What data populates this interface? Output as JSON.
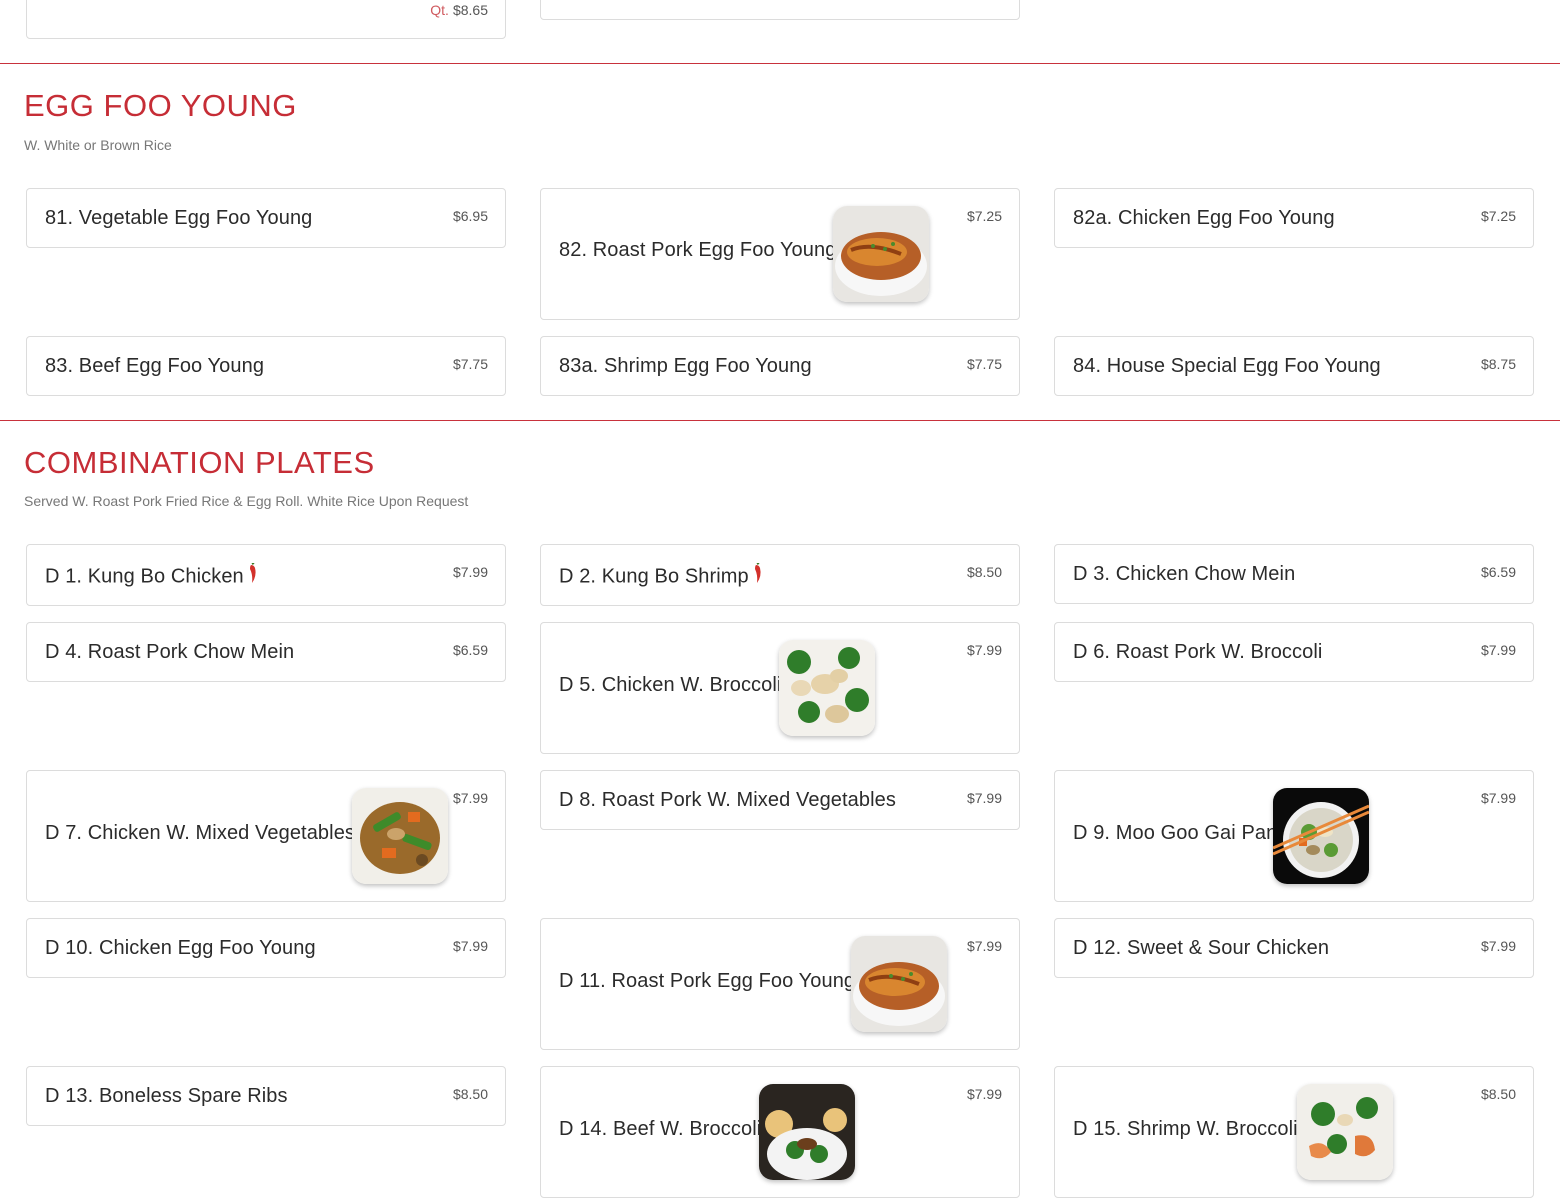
{
  "top_partial": {
    "qt_label": "Qt.",
    "qt_price": "$8.65"
  },
  "egg_foo_young": {
    "title": "EGG FOO YOUNG",
    "subtitle": "W. White or Brown Rice",
    "items": [
      {
        "name": "81. Vegetable Egg Foo Young",
        "price": "$6.95"
      },
      {
        "name": "82. Roast Pork Egg Foo Young",
        "price": "$7.25",
        "image": "egg-foo-young-photo"
      },
      {
        "name": "82a. Chicken Egg Foo Young",
        "price": "$7.25"
      },
      {
        "name": "83. Beef Egg Foo Young",
        "price": "$7.75"
      },
      {
        "name": "83a. Shrimp Egg Foo Young",
        "price": "$7.75"
      },
      {
        "name": "84. House Special Egg Foo Young",
        "price": "$8.75"
      }
    ]
  },
  "combination_plates": {
    "title": "COMBINATION PLATES",
    "subtitle": "Served W. Roast Pork Fried Rice & Egg Roll. White Rice Upon Request",
    "items": [
      {
        "name": "D 1. Kung Bo Chicken",
        "price": "$7.99",
        "spicy": true
      },
      {
        "name": "D 2. Kung Bo Shrimp",
        "price": "$8.50",
        "spicy": true
      },
      {
        "name": "D 3. Chicken Chow Mein",
        "price": "$6.59"
      },
      {
        "name": "D 4. Roast Pork Chow Mein",
        "price": "$6.59"
      },
      {
        "name": "D 5. Chicken W. Broccoli",
        "price": "$7.99",
        "image": "chicken-broccoli-photo"
      },
      {
        "name": "D 6. Roast Pork W. Broccoli",
        "price": "$7.99"
      },
      {
        "name": "D 7. Chicken W. Mixed Vegetables",
        "price": "$7.99",
        "image": "mixed-vegetables-photo"
      },
      {
        "name": "D 8. Roast Pork W. Mixed Vegetables",
        "price": "$7.99"
      },
      {
        "name": "D 9. Moo Goo Gai Pan",
        "price": "$7.99",
        "image": "moo-goo-gai-pan-photo"
      },
      {
        "name": "D 10. Chicken Egg Foo Young",
        "price": "$7.99"
      },
      {
        "name": "D 11. Roast Pork Egg Foo Young",
        "price": "$7.99",
        "image": "egg-foo-young-photo"
      },
      {
        "name": "D 12. Sweet & Sour Chicken",
        "price": "$7.99"
      },
      {
        "name": "D 13. Boneless Spare Ribs",
        "price": "$8.50"
      },
      {
        "name": "D 14. Beef W. Broccoli",
        "price": "$7.99",
        "image": "beef-broccoli-photo"
      },
      {
        "name": "D 15. Shrimp W. Broccoli",
        "price": "$8.50",
        "image": "shrimp-broccoli-photo"
      }
    ]
  },
  "colors": {
    "accent_red": "#c62d36",
    "card_border": "#dcdcdc",
    "chili_red": "#d3312b"
  }
}
